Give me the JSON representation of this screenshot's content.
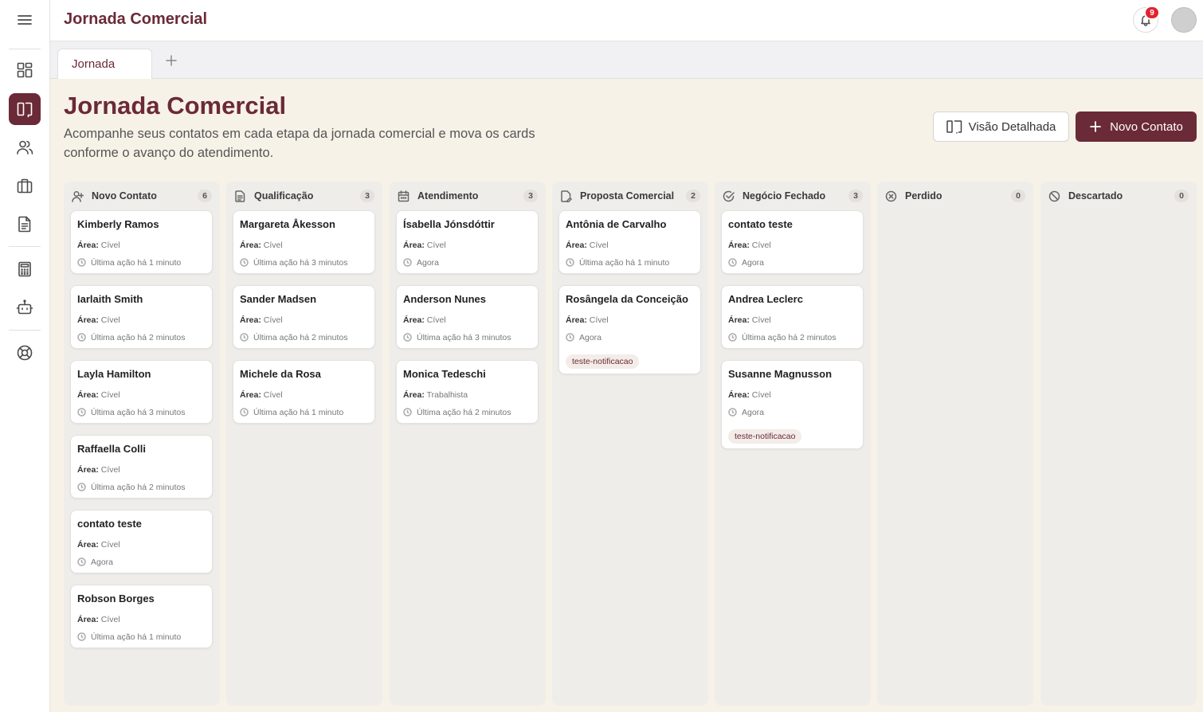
{
  "header": {
    "app_title": "Jornada Comercial",
    "notifications_count": "9"
  },
  "tabs": {
    "items": [
      {
        "label": "Jornada"
      }
    ],
    "add_label": "+"
  },
  "page": {
    "title": "Jornada Comercial",
    "description": "Acompanhe seus contatos em cada etapa da jornada comercial e mova os cards conforme o avanço do atendimento.",
    "detailed_view_label": "Visão Detalhada",
    "new_contact_label": "Novo Contato"
  },
  "sidebar": {
    "items": [
      "dashboard-icon",
      "kanban-icon",
      "users-icon",
      "briefcase-icon",
      "document-icon",
      "calculator-icon",
      "robot-icon",
      "lifebuoy-icon"
    ],
    "active": "kanban-icon"
  },
  "board": {
    "area_label": "Área:",
    "columns": [
      {
        "title": "Novo Contato",
        "count": "6",
        "icon": "user-plus-icon",
        "cards": [
          {
            "name": "Kimberly Ramos",
            "area": "Cível",
            "time": "Última ação há 1 minuto"
          },
          {
            "name": "Iarlaith Smith",
            "area": "Cível",
            "time": "Última ação há 2 minutos"
          },
          {
            "name": "Layla Hamilton",
            "area": "Cível",
            "time": "Última ação há 3 minutos"
          },
          {
            "name": "Raffaella Colli",
            "area": "Cível",
            "time": "Última ação há 2 minutos"
          },
          {
            "name": "contato teste",
            "area": "Cível",
            "time": "Agora"
          },
          {
            "name": "Robson Borges",
            "area": "Cível",
            "time": "Última ação há 1 minuto"
          }
        ]
      },
      {
        "title": "Qualificação",
        "count": "3",
        "icon": "file-text-icon",
        "cards": [
          {
            "name": "Margareta Åkesson",
            "area": "Cível",
            "time": "Última ação há 3 minutos"
          },
          {
            "name": "Sander Madsen",
            "area": "Cível",
            "time": "Última ação há 2 minutos"
          },
          {
            "name": "Michele da Rosa",
            "area": "Cível",
            "time": "Última ação há 1 minuto"
          }
        ]
      },
      {
        "title": "Atendimento",
        "count": "3",
        "icon": "calendar-icon",
        "cards": [
          {
            "name": "Ísabella Jónsdóttir",
            "area": "Cível",
            "time": "Agora"
          },
          {
            "name": "Anderson Nunes",
            "area": "Cível",
            "time": "Última ação há 3 minutos"
          },
          {
            "name": "Monica Tedeschi",
            "area": "Trabalhista",
            "time": "Última ação há 2 minutos"
          }
        ]
      },
      {
        "title": "Proposta Comercial",
        "count": "2",
        "icon": "file-edit-icon",
        "cards": [
          {
            "name": "Antônia de Carvalho",
            "area": "Cível",
            "time": "Última ação há 1 minuto"
          },
          {
            "name": "Rosângela da Conceição",
            "area": "Cível",
            "time": "Agora",
            "tag": "teste-notificacao"
          }
        ]
      },
      {
        "title": "Negócio Fechado",
        "count": "3",
        "icon": "check-circle-icon",
        "cards": [
          {
            "name": "contato teste",
            "area": "Cível",
            "time": "Agora"
          },
          {
            "name": "Andrea Leclerc",
            "area": "Cível",
            "time": "Última ação há 2 minutos"
          },
          {
            "name": "Susanne Magnusson",
            "area": "Cível",
            "time": "Agora",
            "tag": "teste-notificacao"
          }
        ]
      },
      {
        "title": "Perdido",
        "count": "0",
        "icon": "x-circle-icon",
        "cards": []
      },
      {
        "title": "Descartado",
        "count": "0",
        "icon": "ban-icon",
        "cards": []
      }
    ]
  }
}
